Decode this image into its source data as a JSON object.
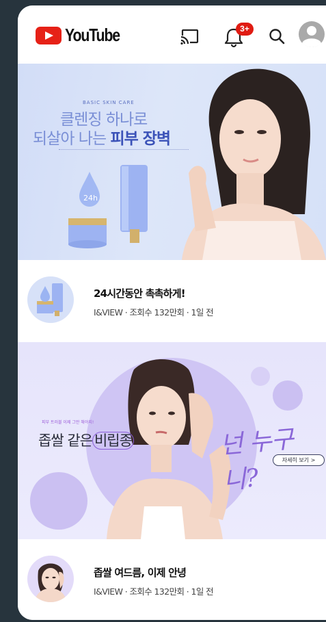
{
  "header": {
    "logo_text": "YouTube",
    "notification_badge": "3+",
    "icons": [
      "cast-icon",
      "bell-icon",
      "search-icon",
      "account-avatar-icon"
    ],
    "brand_red": "#e62117"
  },
  "banners": [
    {
      "kicker": "BASIC SKIN CARE",
      "headline_line1": "클렌징 하나로",
      "headline_line2_plain": "되살아 나는",
      "headline_line2_bold": "피부 장벽",
      "product_badge": "24h"
    },
    {
      "kicker": "피부 트러블 이제 그만 해야지!",
      "headline_plain": "좁쌀 같은",
      "headline_circled": "비립종",
      "script_text": "넌 누구니?",
      "cta": "자세히 보기 >"
    }
  ],
  "videos": [
    {
      "title": "24시간동안 촉촉하게!",
      "meta": "I&VIEW · 조회수 132만회 · 1일 전"
    },
    {
      "title": "좁쌀 여드름, 이제 안녕",
      "meta": "I&VIEW · 조회수 132만회 · 1일 전"
    }
  ]
}
